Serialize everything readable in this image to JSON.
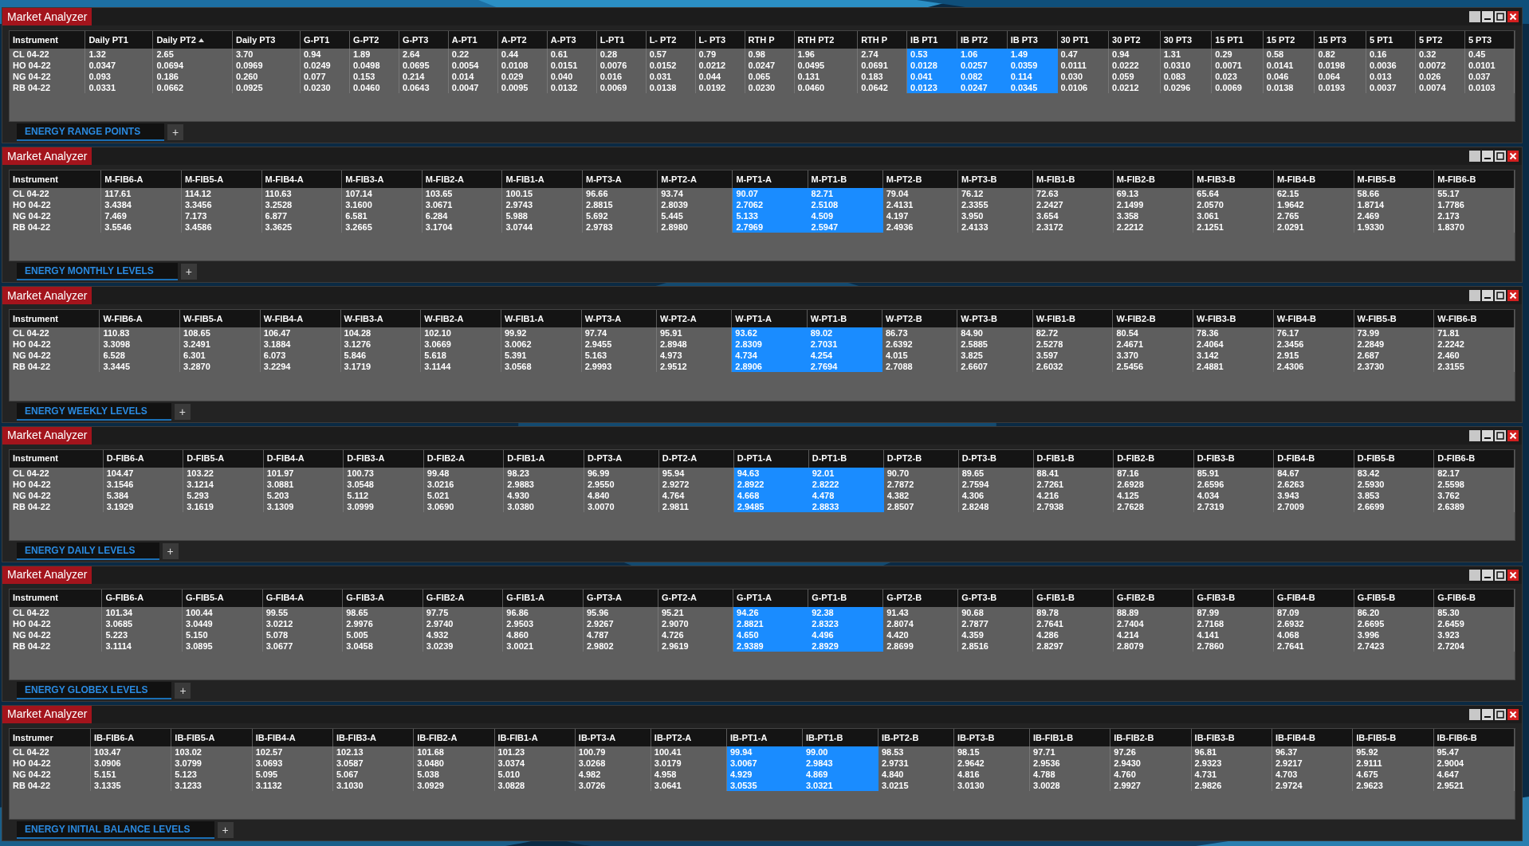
{
  "panels": [
    {
      "title": "Market Analyzer",
      "tab": {
        "label": "ENERGY RANGE POINTS",
        "selected": true
      },
      "add_tab": "+",
      "columns": [
        {
          "label": "Instrument",
          "highlighted": false,
          "sorted": false
        },
        {
          "label": "Daily PT1",
          "highlighted": false,
          "sorted": false
        },
        {
          "label": "Daily PT2",
          "highlighted": false,
          "sorted": true
        },
        {
          "label": "Daily PT3",
          "highlighted": false,
          "sorted": false
        },
        {
          "label": "G-PT1",
          "highlighted": false,
          "sorted": false
        },
        {
          "label": "G-PT2",
          "highlighted": false,
          "sorted": false
        },
        {
          "label": "G-PT3",
          "highlighted": false,
          "sorted": false
        },
        {
          "label": "A-PT1",
          "highlighted": false,
          "sorted": false
        },
        {
          "label": "A-PT2",
          "highlighted": false,
          "sorted": false
        },
        {
          "label": "A-PT3",
          "highlighted": false,
          "sorted": false
        },
        {
          "label": "L-PT1",
          "highlighted": false,
          "sorted": false
        },
        {
          "label": "L- PT2",
          "highlighted": false,
          "sorted": false
        },
        {
          "label": "L- PT3",
          "highlighted": false,
          "sorted": false
        },
        {
          "label": "RTH P",
          "highlighted": false,
          "sorted": false
        },
        {
          "label": "RTH PT2",
          "highlighted": false,
          "sorted": false
        },
        {
          "label": "RTH P",
          "highlighted": false,
          "sorted": false
        },
        {
          "label": "IB PT1",
          "highlighted": true,
          "sorted": false
        },
        {
          "label": "IB PT2",
          "highlighted": true,
          "sorted": false
        },
        {
          "label": "IB PT3",
          "highlighted": true,
          "sorted": false
        },
        {
          "label": "30 PT1",
          "highlighted": false,
          "sorted": false
        },
        {
          "label": "30 PT2",
          "highlighted": false,
          "sorted": false
        },
        {
          "label": "30 PT3",
          "highlighted": false,
          "sorted": false
        },
        {
          "label": "15 PT1",
          "highlighted": false,
          "sorted": false
        },
        {
          "label": "15 PT2",
          "highlighted": false,
          "sorted": false
        },
        {
          "label": "15 PT3",
          "highlighted": false,
          "sorted": false
        },
        {
          "label": "5 PT1",
          "highlighted": false,
          "sorted": false
        },
        {
          "label": "5 PT2",
          "highlighted": false,
          "sorted": false
        },
        {
          "label": "5 PT3",
          "highlighted": false,
          "sorted": false
        }
      ],
      "rows": [
        {
          "cells": [
            "CL 04-22",
            "1.32",
            "2.65",
            "3.70",
            "0.94",
            "1.89",
            "2.64",
            "0.22",
            "0.44",
            "0.61",
            "0.28",
            "0.57",
            "0.79",
            "0.98",
            "1.96",
            "2.74",
            "0.53",
            "1.06",
            "1.49",
            "0.47",
            "0.94",
            "1.31",
            "0.29",
            "0.58",
            "0.82",
            "0.16",
            "0.32",
            "0.45"
          ]
        },
        {
          "cells": [
            "HO 04-22",
            "0.0347",
            "0.0694",
            "0.0969",
            "0.0249",
            "0.0498",
            "0.0695",
            "0.0054",
            "0.0108",
            "0.0151",
            "0.0076",
            "0.0152",
            "0.0212",
            "0.0247",
            "0.0495",
            "0.0691",
            "0.0128",
            "0.0257",
            "0.0359",
            "0.0111",
            "0.0222",
            "0.0310",
            "0.0071",
            "0.0141",
            "0.0198",
            "0.0036",
            "0.0072",
            "0.0101"
          ]
        },
        {
          "cells": [
            "NG 04-22",
            "0.093",
            "0.186",
            "0.260",
            "0.077",
            "0.153",
            "0.214",
            "0.014",
            "0.029",
            "0.040",
            "0.016",
            "0.031",
            "0.044",
            "0.065",
            "0.131",
            "0.183",
            "0.041",
            "0.082",
            "0.114",
            "0.030",
            "0.059",
            "0.083",
            "0.023",
            "0.046",
            "0.064",
            "0.013",
            "0.026",
            "0.037"
          ]
        },
        {
          "cells": [
            "RB 04-22",
            "0.0331",
            "0.0662",
            "0.0925",
            "0.0230",
            "0.0460",
            "0.0643",
            "0.0047",
            "0.0095",
            "0.0132",
            "0.0069",
            "0.0138",
            "0.0192",
            "0.0230",
            "0.0460",
            "0.0642",
            "0.0123",
            "0.0247",
            "0.0345",
            "0.0106",
            "0.0212",
            "0.0296",
            "0.0069",
            "0.0138",
            "0.0193",
            "0.0037",
            "0.0074",
            "0.0103"
          ]
        }
      ]
    },
    {
      "title": "Market Analyzer",
      "tab": {
        "label": "ENERGY MONTHLY LEVELS",
        "selected": true
      },
      "add_tab": "+",
      "columns": [
        {
          "label": "Instrument",
          "highlighted": false
        },
        {
          "label": "M-FIB6-A",
          "highlighted": false
        },
        {
          "label": "M-FIB5-A",
          "highlighted": false
        },
        {
          "label": "M-FIB4-A",
          "highlighted": false
        },
        {
          "label": "M-FIB3-A",
          "highlighted": false
        },
        {
          "label": "M-FIB2-A",
          "highlighted": false
        },
        {
          "label": "M-FIB1-A",
          "highlighted": false
        },
        {
          "label": "M-PT3-A",
          "highlighted": false
        },
        {
          "label": "M-PT2-A",
          "highlighted": false
        },
        {
          "label": "M-PT1-A",
          "highlighted": true
        },
        {
          "label": "M-PT1-B",
          "highlighted": true
        },
        {
          "label": "M-PT2-B",
          "highlighted": false
        },
        {
          "label": "M-PT3-B",
          "highlighted": false
        },
        {
          "label": "M-FIB1-B",
          "highlighted": false
        },
        {
          "label": "M-FIB2-B",
          "highlighted": false
        },
        {
          "label": "M-FIB3-B",
          "highlighted": false
        },
        {
          "label": "M-FIB4-B",
          "highlighted": false
        },
        {
          "label": "M-FIB5-B",
          "highlighted": false
        },
        {
          "label": "M-FIB6-B",
          "highlighted": false
        }
      ],
      "rows": [
        {
          "cells": [
            "CL 04-22",
            "117.61",
            "114.12",
            "110.63",
            "107.14",
            "103.65",
            "100.15",
            "96.66",
            "93.74",
            "90.07",
            "82.71",
            "79.04",
            "76.12",
            "72.63",
            "69.13",
            "65.64",
            "62.15",
            "58.66",
            "55.17"
          ]
        },
        {
          "cells": [
            "HO 04-22",
            "3.4384",
            "3.3456",
            "3.2528",
            "3.1600",
            "3.0671",
            "2.9743",
            "2.8815",
            "2.8039",
            "2.7062",
            "2.5108",
            "2.4131",
            "2.3355",
            "2.2427",
            "2.1499",
            "2.0570",
            "1.9642",
            "1.8714",
            "1.7786"
          ]
        },
        {
          "cells": [
            "NG 04-22",
            "7.469",
            "7.173",
            "6.877",
            "6.581",
            "6.284",
            "5.988",
            "5.692",
            "5.445",
            "5.133",
            "4.509",
            "4.197",
            "3.950",
            "3.654",
            "3.358",
            "3.061",
            "2.765",
            "2.469",
            "2.173"
          ]
        },
        {
          "cells": [
            "RB 04-22",
            "3.5546",
            "3.4586",
            "3.3625",
            "3.2665",
            "3.1704",
            "3.0744",
            "2.9783",
            "2.8980",
            "2.7969",
            "2.5947",
            "2.4936",
            "2.4133",
            "2.3172",
            "2.2212",
            "2.1251",
            "2.0291",
            "1.9330",
            "1.8370"
          ]
        }
      ]
    },
    {
      "title": "Market Analyzer",
      "tab": {
        "label": "ENERGY WEEKLY LEVELS",
        "selected": true
      },
      "add_tab": "+",
      "columns": [
        {
          "label": "Instrument",
          "highlighted": false
        },
        {
          "label": "W-FIB6-A",
          "highlighted": false
        },
        {
          "label": "W-FIB5-A",
          "highlighted": false
        },
        {
          "label": "W-FIB4-A",
          "highlighted": false
        },
        {
          "label": "W-FIB3-A",
          "highlighted": false
        },
        {
          "label": "W-FIB2-A",
          "highlighted": false
        },
        {
          "label": "W-FIB1-A",
          "highlighted": false
        },
        {
          "label": "W-PT3-A",
          "highlighted": false
        },
        {
          "label": "W-PT2-A",
          "highlighted": false
        },
        {
          "label": "W-PT1-A",
          "highlighted": true
        },
        {
          "label": "W-PT1-B",
          "highlighted": true
        },
        {
          "label": "W-PT2-B",
          "highlighted": false
        },
        {
          "label": "W-PT3-B",
          "highlighted": false
        },
        {
          "label": "W-FIB1-B",
          "highlighted": false
        },
        {
          "label": "W-FIB2-B",
          "highlighted": false
        },
        {
          "label": "W-FIB3-B",
          "highlighted": false
        },
        {
          "label": "W-FIB4-B",
          "highlighted": false
        },
        {
          "label": "W-FIB5-B",
          "highlighted": false
        },
        {
          "label": "W-FIB6-B",
          "highlighted": false
        }
      ],
      "rows": [
        {
          "cells": [
            "CL 04-22",
            "110.83",
            "108.65",
            "106.47",
            "104.28",
            "102.10",
            "99.92",
            "97.74",
            "95.91",
            "93.62",
            "89.02",
            "86.73",
            "84.90",
            "82.72",
            "80.54",
            "78.36",
            "76.17",
            "73.99",
            "71.81"
          ]
        },
        {
          "cells": [
            "HO 04-22",
            "3.3098",
            "3.2491",
            "3.1884",
            "3.1276",
            "3.0669",
            "3.0062",
            "2.9455",
            "2.8948",
            "2.8309",
            "2.7031",
            "2.6392",
            "2.5885",
            "2.5278",
            "2.4671",
            "2.4064",
            "2.3456",
            "2.2849",
            "2.2242"
          ]
        },
        {
          "cells": [
            "NG 04-22",
            "6.528",
            "6.301",
            "6.073",
            "5.846",
            "5.618",
            "5.391",
            "5.163",
            "4.973",
            "4.734",
            "4.254",
            "4.015",
            "3.825",
            "3.597",
            "3.370",
            "3.142",
            "2.915",
            "2.687",
            "2.460"
          ]
        },
        {
          "cells": [
            "RB 04-22",
            "3.3445",
            "3.2870",
            "3.2294",
            "3.1719",
            "3.1144",
            "3.0568",
            "2.9993",
            "2.9512",
            "2.8906",
            "2.7694",
            "2.7088",
            "2.6607",
            "2.6032",
            "2.5456",
            "2.4881",
            "2.4306",
            "2.3730",
            "2.3155"
          ]
        }
      ]
    },
    {
      "title": "Market Analyzer",
      "tab": {
        "label": "ENERGY DAILY LEVELS",
        "selected": true
      },
      "add_tab": "+",
      "columns": [
        {
          "label": "Instrument",
          "highlighted": false
        },
        {
          "label": "D-FIB6-A",
          "highlighted": false
        },
        {
          "label": "D-FIB5-A",
          "highlighted": false
        },
        {
          "label": "D-FIB4-A",
          "highlighted": false
        },
        {
          "label": "D-FIB3-A",
          "highlighted": false
        },
        {
          "label": "D-FIB2-A",
          "highlighted": false
        },
        {
          "label": "D-FIB1-A",
          "highlighted": false
        },
        {
          "label": "D-PT3-A",
          "highlighted": false
        },
        {
          "label": "D-PT2-A",
          "highlighted": false
        },
        {
          "label": "D-PT1-A",
          "highlighted": true
        },
        {
          "label": "D-PT1-B",
          "highlighted": true
        },
        {
          "label": "D-PT2-B",
          "highlighted": false
        },
        {
          "label": "D-PT3-B",
          "highlighted": false
        },
        {
          "label": "D-FIB1-B",
          "highlighted": false
        },
        {
          "label": "D-FIB2-B",
          "highlighted": false
        },
        {
          "label": "D-FIB3-B",
          "highlighted": false
        },
        {
          "label": "D-FIB4-B",
          "highlighted": false
        },
        {
          "label": "D-FIB5-B",
          "highlighted": false
        },
        {
          "label": "D-FIB6-B",
          "highlighted": false
        }
      ],
      "rows": [
        {
          "cells": [
            "CL 04-22",
            "104.47",
            "103.22",
            "101.97",
            "100.73",
            "99.48",
            "98.23",
            "96.99",
            "95.94",
            "94.63",
            "92.01",
            "90.70",
            "89.65",
            "88.41",
            "87.16",
            "85.91",
            "84.67",
            "83.42",
            "82.17"
          ]
        },
        {
          "cells": [
            "HO 04-22",
            "3.1546",
            "3.1214",
            "3.0881",
            "3.0548",
            "3.0216",
            "2.9883",
            "2.9550",
            "2.9272",
            "2.8922",
            "2.8222",
            "2.7872",
            "2.7594",
            "2.7261",
            "2.6928",
            "2.6596",
            "2.6263",
            "2.5930",
            "2.5598"
          ]
        },
        {
          "cells": [
            "NG 04-22",
            "5.384",
            "5.293",
            "5.203",
            "5.112",
            "5.021",
            "4.930",
            "4.840",
            "4.764",
            "4.668",
            "4.478",
            "4.382",
            "4.306",
            "4.216",
            "4.125",
            "4.034",
            "3.943",
            "3.853",
            "3.762"
          ]
        },
        {
          "cells": [
            "RB 04-22",
            "3.1929",
            "3.1619",
            "3.1309",
            "3.0999",
            "3.0690",
            "3.0380",
            "3.0070",
            "2.9811",
            "2.9485",
            "2.8833",
            "2.8507",
            "2.8248",
            "2.7938",
            "2.7628",
            "2.7319",
            "2.7009",
            "2.6699",
            "2.6389"
          ]
        }
      ]
    },
    {
      "title": "Market Analyzer",
      "tab": {
        "label": "ENERGY GLOBEX LEVELS",
        "selected": true
      },
      "add_tab": "+",
      "columns": [
        {
          "label": "Instrument",
          "highlighted": false
        },
        {
          "label": "G-FIB6-A",
          "highlighted": false
        },
        {
          "label": "G-FIB5-A",
          "highlighted": false
        },
        {
          "label": "G-FIB4-A",
          "highlighted": false
        },
        {
          "label": "G-FIB3-A",
          "highlighted": false
        },
        {
          "label": "G-FIB2-A",
          "highlighted": false
        },
        {
          "label": "G-FIB1-A",
          "highlighted": false
        },
        {
          "label": "G-PT3-A",
          "highlighted": false
        },
        {
          "label": "G-PT2-A",
          "highlighted": false
        },
        {
          "label": "G-PT1-A",
          "highlighted": true
        },
        {
          "label": "G-PT1-B",
          "highlighted": true
        },
        {
          "label": "G-PT2-B",
          "highlighted": false
        },
        {
          "label": "G-PT3-B",
          "highlighted": false
        },
        {
          "label": "G-FIB1-B",
          "highlighted": false
        },
        {
          "label": "G-FIB2-B",
          "highlighted": false
        },
        {
          "label": "G-FIB3-B",
          "highlighted": false
        },
        {
          "label": "G-FIB4-B",
          "highlighted": false
        },
        {
          "label": "G-FIB5-B",
          "highlighted": false
        },
        {
          "label": "G-FIB6-B",
          "highlighted": false
        }
      ],
      "rows": [
        {
          "cells": [
            "CL 04-22",
            "101.34",
            "100.44",
            "99.55",
            "98.65",
            "97.75",
            "96.86",
            "95.96",
            "95.21",
            "94.26",
            "92.38",
            "91.43",
            "90.68",
            "89.78",
            "88.89",
            "87.99",
            "87.09",
            "86.20",
            "85.30"
          ]
        },
        {
          "cells": [
            "HO 04-22",
            "3.0685",
            "3.0449",
            "3.0212",
            "2.9976",
            "2.9740",
            "2.9503",
            "2.9267",
            "2.9070",
            "2.8821",
            "2.8323",
            "2.8074",
            "2.7877",
            "2.7641",
            "2.7404",
            "2.7168",
            "2.6932",
            "2.6695",
            "2.6459"
          ]
        },
        {
          "cells": [
            "NG 04-22",
            "5.223",
            "5.150",
            "5.078",
            "5.005",
            "4.932",
            "4.860",
            "4.787",
            "4.726",
            "4.650",
            "4.496",
            "4.420",
            "4.359",
            "4.286",
            "4.214",
            "4.141",
            "4.068",
            "3.996",
            "3.923"
          ]
        },
        {
          "cells": [
            "RB 04-22",
            "3.1114",
            "3.0895",
            "3.0677",
            "3.0458",
            "3.0239",
            "3.0021",
            "2.9802",
            "2.9619",
            "2.9389",
            "2.8929",
            "2.8699",
            "2.8516",
            "2.8297",
            "2.8079",
            "2.7860",
            "2.7641",
            "2.7423",
            "2.7204"
          ]
        }
      ]
    },
    {
      "title": "Market Analyzer",
      "tab": {
        "label": "ENERGY INITIAL BALANCE LEVELS",
        "selected": true
      },
      "add_tab": "+",
      "columns": [
        {
          "label": "Instrumer",
          "highlighted": false
        },
        {
          "label": "IB-FIB6-A",
          "highlighted": false
        },
        {
          "label": "IB-FIB5-A",
          "highlighted": false
        },
        {
          "label": "IB-FIB4-A",
          "highlighted": false
        },
        {
          "label": "IB-FIB3-A",
          "highlighted": false
        },
        {
          "label": "IB-FIB2-A",
          "highlighted": false
        },
        {
          "label": "IB-FIB1-A",
          "highlighted": false
        },
        {
          "label": "IB-PT3-A",
          "highlighted": false
        },
        {
          "label": "IB-PT2-A",
          "highlighted": false
        },
        {
          "label": "IB-PT1-A",
          "highlighted": true
        },
        {
          "label": "IB-PT1-B",
          "highlighted": true
        },
        {
          "label": "IB-PT2-B",
          "highlighted": false
        },
        {
          "label": "IB-PT3-B",
          "highlighted": false
        },
        {
          "label": "IB-FIB1-B",
          "highlighted": false
        },
        {
          "label": "IB-FIB2-B",
          "highlighted": false
        },
        {
          "label": "IB-FIB3-B",
          "highlighted": false
        },
        {
          "label": "IB-FIB4-B",
          "highlighted": false
        },
        {
          "label": "IB-FIB5-B",
          "highlighted": false
        },
        {
          "label": "IB-FIB6-B",
          "highlighted": false
        }
      ],
      "rows": [
        {
          "cells": [
            "CL 04-22",
            "103.47",
            "103.02",
            "102.57",
            "102.13",
            "101.68",
            "101.23",
            "100.79",
            "100.41",
            "99.94",
            "99.00",
            "98.53",
            "98.15",
            "97.71",
            "97.26",
            "96.81",
            "96.37",
            "95.92",
            "95.47"
          ]
        },
        {
          "cells": [
            "HO 04-22",
            "3.0906",
            "3.0799",
            "3.0693",
            "3.0587",
            "3.0480",
            "3.0374",
            "3.0268",
            "3.0179",
            "3.0067",
            "2.9843",
            "2.9731",
            "2.9642",
            "2.9536",
            "2.9430",
            "2.9323",
            "2.9217",
            "2.9111",
            "2.9004"
          ]
        },
        {
          "cells": [
            "NG 04-22",
            "5.151",
            "5.123",
            "5.095",
            "5.067",
            "5.038",
            "5.010",
            "4.982",
            "4.958",
            "4.929",
            "4.869",
            "4.840",
            "4.816",
            "4.788",
            "4.760",
            "4.731",
            "4.703",
            "4.675",
            "4.647"
          ]
        },
        {
          "cells": [
            "RB 04-22",
            "3.1335",
            "3.1233",
            "3.1132",
            "3.1030",
            "3.0929",
            "3.0828",
            "3.0726",
            "3.0641",
            "3.0535",
            "3.0321",
            "3.0215",
            "3.0130",
            "3.0028",
            "2.9927",
            "2.9826",
            "2.9724",
            "2.9623",
            "2.9521"
          ]
        }
      ]
    }
  ]
}
